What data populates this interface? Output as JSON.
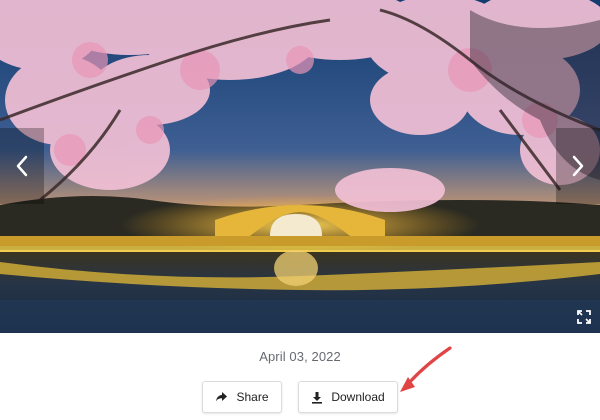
{
  "photo": {
    "alt": "Cherry blossoms over an illuminated arched bridge reflected in water at dusk",
    "prev_icon": "chevron-left-icon",
    "next_icon": "chevron-right-icon",
    "expand_icon": "expand-icon"
  },
  "date": "April 03, 2022",
  "actions": {
    "share_label": "Share",
    "share_icon": "share-arrow-icon",
    "download_label": "Download",
    "download_icon": "download-icon"
  },
  "annotation": {
    "arrow_color": "#e04444"
  },
  "colors": {
    "sky_top": "#0f3566",
    "sky_glow": "#f3b56a",
    "blossom": "#f3c3d6",
    "bridge_light": "#f5d13a",
    "water": "#1b2d45"
  }
}
